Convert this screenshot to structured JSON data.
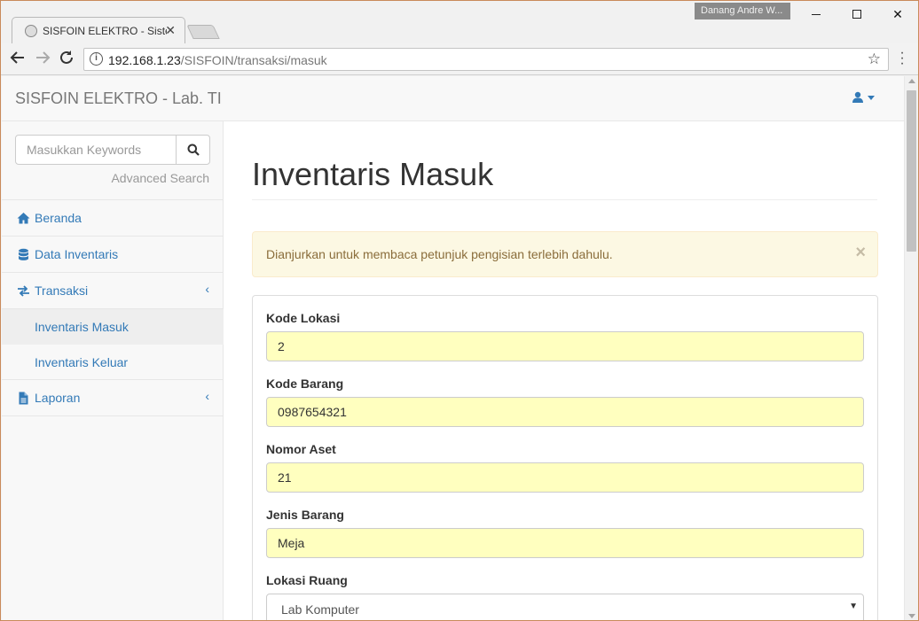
{
  "browser": {
    "tab_title": "SISFOIN ELEKTRO - Sistem",
    "profile_name": "Danang Andre W...",
    "url_host": "192.168.1.23",
    "url_path": "/SISFOIN/transaksi/masuk"
  },
  "navbar": {
    "brand": "SISFOIN ELEKTRO - Lab. TI"
  },
  "sidebar": {
    "search_placeholder": "Masukkan Keywords",
    "advanced_search": "Advanced Search",
    "items": [
      {
        "label": "Beranda",
        "icon": "home-icon"
      },
      {
        "label": "Data Inventaris",
        "icon": "database-icon"
      },
      {
        "label": "Transaksi",
        "icon": "exchange-icon",
        "arrow": "‹"
      },
      {
        "label": "Inventaris Masuk",
        "active": true
      },
      {
        "label": "Inventaris Keluar"
      },
      {
        "label": "Laporan",
        "icon": "file-icon",
        "arrow": "‹"
      }
    ]
  },
  "main": {
    "title": "Inventaris Masuk",
    "alert": "Dianjurkan untuk membaca petunjuk pengisian terlebih dahulu.",
    "alert_close": "×",
    "fields": [
      {
        "label": "Kode Lokasi",
        "value": "2"
      },
      {
        "label": "Kode Barang",
        "value": "0987654321"
      },
      {
        "label": "Nomor Aset",
        "value": "21"
      },
      {
        "label": "Jenis Barang",
        "value": "Meja"
      },
      {
        "label": "Lokasi Ruang",
        "value": "Lab Komputer"
      }
    ]
  },
  "colors": {
    "link": "#337ab7",
    "autofill": "#ffffbf",
    "alert_bg": "#fcf8e3",
    "alert_text": "#8a6d3b"
  }
}
